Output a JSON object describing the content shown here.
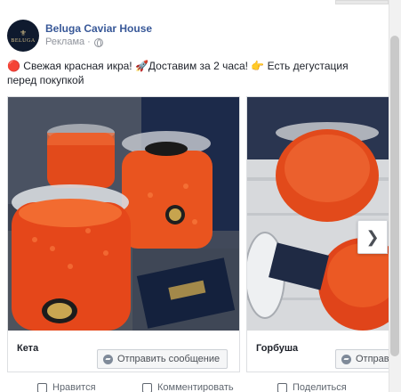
{
  "post": {
    "page_name": "Beluga Caviar House",
    "avatar_text": "BELUGA",
    "sponsored_label": "Реклама ·",
    "text_emoji_1": "🔴",
    "text_part_1": " Свежая красная икра! ",
    "text_emoji_2": "🚀",
    "text_part_2": "Доставим за 2 часа! ",
    "text_emoji_3": "👉",
    "text_part_3": " Есть дегустация перед покупкой"
  },
  "carousel": {
    "cards": [
      {
        "title": "Кета",
        "cta_label": "Отправить сообщение"
      },
      {
        "title": "Горбуша",
        "cta_label": "Отправить сообщение"
      }
    ],
    "next_icon": "chevron-right-icon"
  },
  "actions": [
    {
      "label": "Нравится",
      "icon": "like-icon"
    },
    {
      "label": "Комментировать",
      "icon": "comment-icon"
    },
    {
      "label": "Поделиться",
      "icon": "share-icon"
    }
  ],
  "colors": {
    "page_name": "#385898",
    "caviar": "#e8531f",
    "box": "#1c2a4a"
  }
}
